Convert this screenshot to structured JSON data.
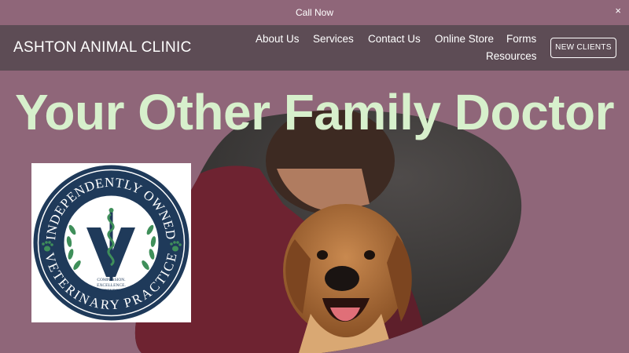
{
  "announcement": {
    "text": "Call Now",
    "close_icon": "×"
  },
  "header": {
    "brand": "ASHTON ANIMAL CLINIC",
    "nav": {
      "about": "About Us",
      "services": "Services",
      "contact": "Contact Us",
      "store": "Online Store",
      "forms": "Forms",
      "resources": "Resources"
    },
    "cta": "NEW CLIENTS"
  },
  "hero": {
    "title": "Your Other Family Doctor",
    "badge": {
      "top_text": "INDEPENDENTLY OWNED",
      "bottom_text": "VETERINARY PRACTICE",
      "motto": [
        "COMPASSION.",
        "EXCELLENCE.",
        "INDEPENDENCE."
      ]
    }
  },
  "colors": {
    "background": "#8f6679",
    "header": "#5d4c55",
    "title": "#d7f0cc",
    "badge_navy": "#1f3a5a",
    "badge_green": "#3f8f5a"
  }
}
